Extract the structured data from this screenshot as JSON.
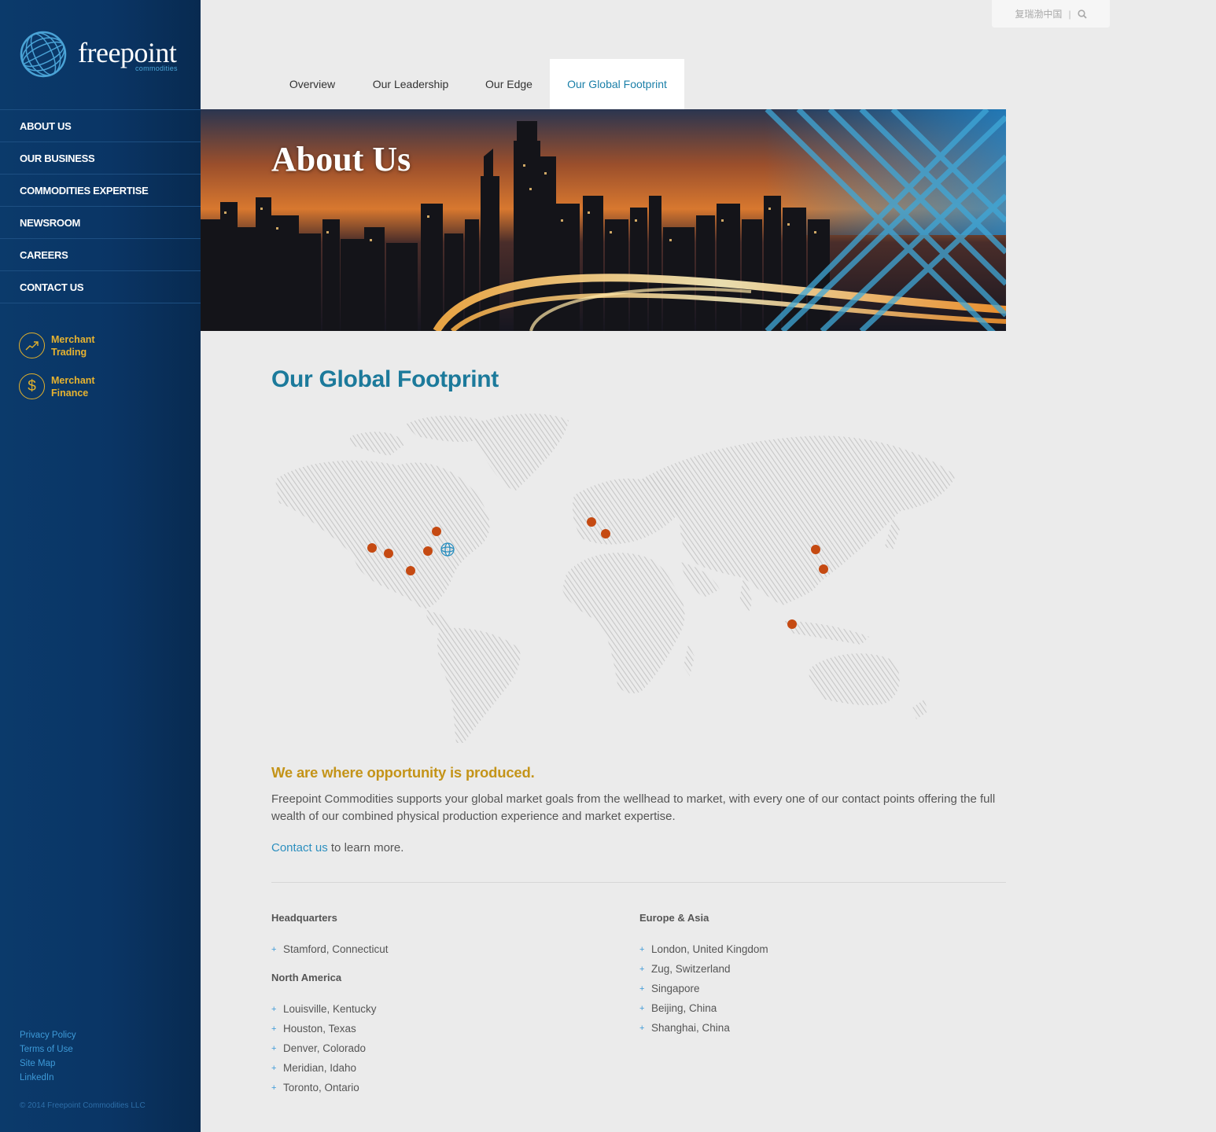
{
  "brand": {
    "name": "freepoint",
    "sub": "commodities"
  },
  "sidebar": {
    "nav": [
      "ABOUT US",
      "OUR BUSINESS",
      "COMMODITIES EXPERTISE",
      "NEWSROOM",
      "CAREERS",
      "CONTACT US"
    ],
    "merchant_trading": {
      "line1": "Merchant",
      "line2": "Trading"
    },
    "merchant_finance": {
      "line1": "Merchant",
      "line2": "Finance"
    },
    "footer_links": [
      "Privacy Policy",
      "Terms of Use",
      "Site Map",
      "LinkedIn"
    ],
    "copyright": "© 2014 Freepoint Commodities LLC"
  },
  "utility": {
    "language": "复瑞渤中国",
    "separator": "|"
  },
  "tabs": [
    "Overview",
    "Our Leadership",
    "Our Edge",
    "Our Global Footprint"
  ],
  "hero": {
    "title": "About Us"
  },
  "main": {
    "heading": "Our Global Footprint",
    "tagline": "We are where opportunity is produced.",
    "paragraph": "Freepoint Commodities supports your global market goals from the wellhead to market, with every one of our contact points offering the full wealth of our combined physical production experience and market expertise.",
    "contact_link": "Contact us",
    "contact_rest": " to learn more."
  },
  "locations": {
    "headquarters": {
      "title": "Headquarters",
      "items": [
        "Stamford, Connecticut"
      ]
    },
    "north_america": {
      "title": "North America",
      "items": [
        "Louisville, Kentucky",
        "Houston, Texas",
        "Denver, Colorado",
        "Meridian, Idaho",
        "Toronto, Ontario"
      ]
    },
    "europe_asia": {
      "title": "Europe & Asia",
      "items": [
        "London, United Kingdom",
        "Zug, Switzerland",
        "Singapore",
        "Beijing, China",
        "Shanghai, China"
      ]
    }
  },
  "colors": {
    "sidebar": "#0b3a6b",
    "heading": "#1c7a9b",
    "tagline": "#c49419",
    "marker": "#c54a12",
    "link": "#2c8fbf"
  }
}
